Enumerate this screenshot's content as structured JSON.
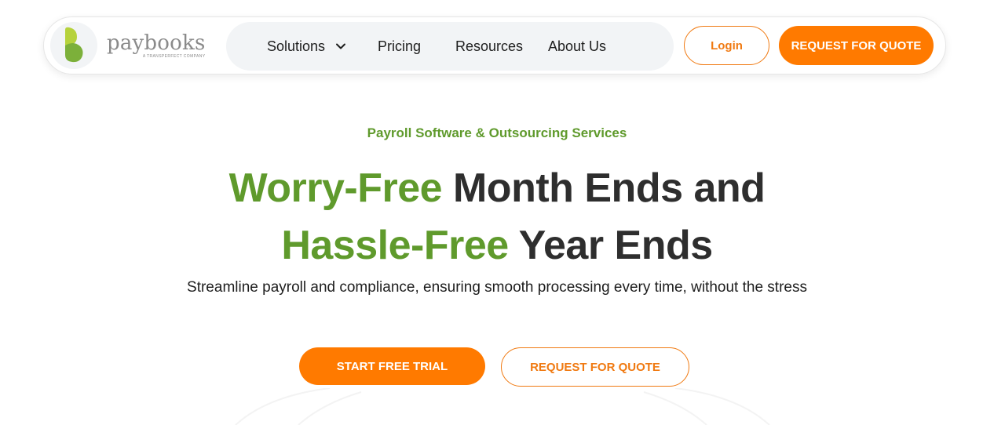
{
  "brand": {
    "name": "paybooks",
    "tagline": "A TRANSPERFECT COMPANY",
    "icon": "paybooks-logo-icon",
    "colors": {
      "logo_light": "#b6d23c",
      "logo_dark": "#7cb03a"
    }
  },
  "nav": {
    "items": [
      {
        "label": "Solutions",
        "has_dropdown": true
      },
      {
        "label": "Pricing"
      },
      {
        "label": "Resources"
      },
      {
        "label": "About Us"
      }
    ],
    "login_label": "Login",
    "quote_label": "REQUEST FOR QUOTE"
  },
  "hero": {
    "eyebrow": "Payroll Software & Outsourcing Services",
    "line1_green": "Worry-Free",
    "line1_rest": " Month Ends and",
    "line2_green": "Hassle-Free",
    "line2_rest": " Year Ends",
    "subtitle": "Streamline payroll and compliance, ensuring smooth processing every time, without the stress",
    "primary_cta": "START FREE TRIAL",
    "secondary_cta": "REQUEST FOR QUOTE"
  },
  "colors": {
    "accent": "#ff7a00",
    "green": "#5f9a2c",
    "text": "#2e2e2e"
  }
}
